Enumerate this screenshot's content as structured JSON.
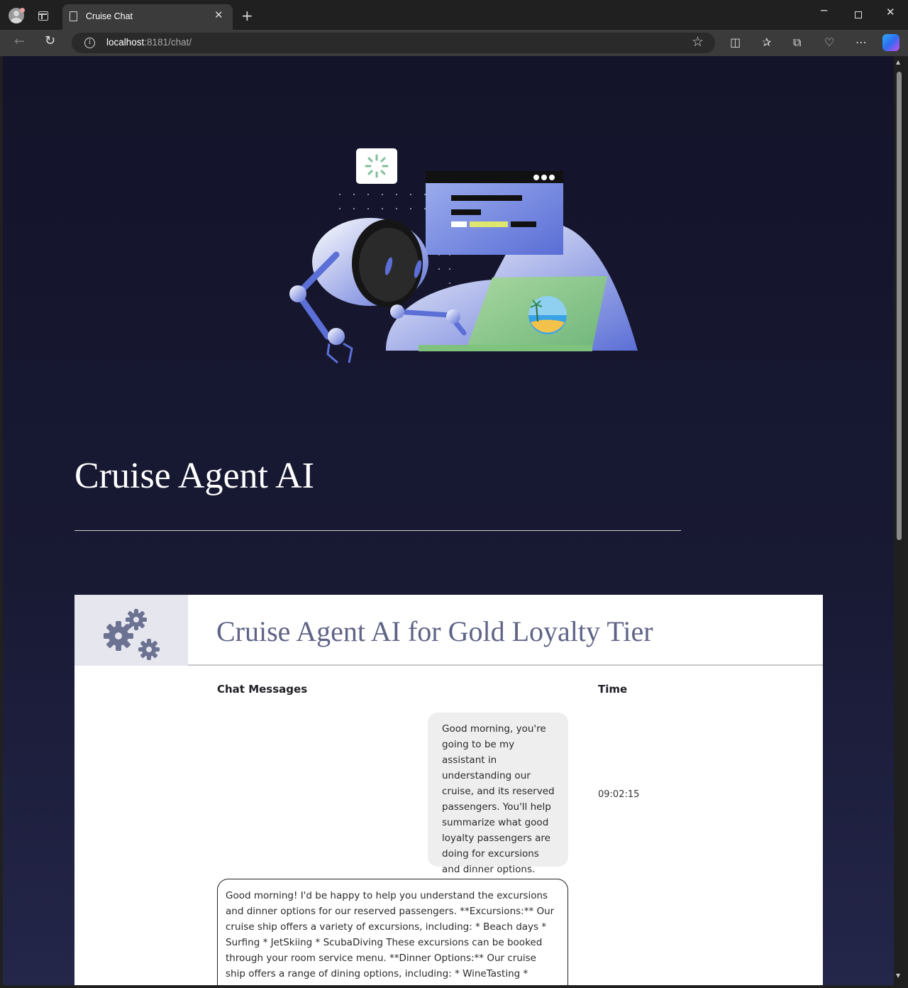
{
  "browser": {
    "tab_title": "Cruise Chat",
    "url_host": "localhost",
    "url_rest": ":8181/chat/"
  },
  "page": {
    "heading": "Cruise Agent AI",
    "card_title": "Cruise Agent AI for Gold Loyalty Tier",
    "columns": {
      "messages": "Chat Messages",
      "time": "Time"
    },
    "messages": [
      {
        "role": "user",
        "text": "Good morning, you're going to be my assistant in understanding our cruise, and its reserved passengers. You'll help summarize what good loyalty passengers are doing for excursions and dinner options.",
        "time": "09:02:15"
      },
      {
        "role": "assistant",
        "text": "Good morning! I'd be happy to help you understand the excursions and dinner options for our reserved passengers. **Excursions:** Our cruise ship offers a variety of excursions, including: * Beach days * Surfing * JetSkiing * ScubaDiving These excursions can be booked through your room service menu. **Dinner Options:** Our cruise ship offers a range of dining options, including: * WineTasting * Italian * Sushi Please note that meal options are"
      }
    ]
  },
  "colors": {
    "page_bg": "#181933",
    "card_title": "#5f6487",
    "accent": "#5b6fd6"
  }
}
